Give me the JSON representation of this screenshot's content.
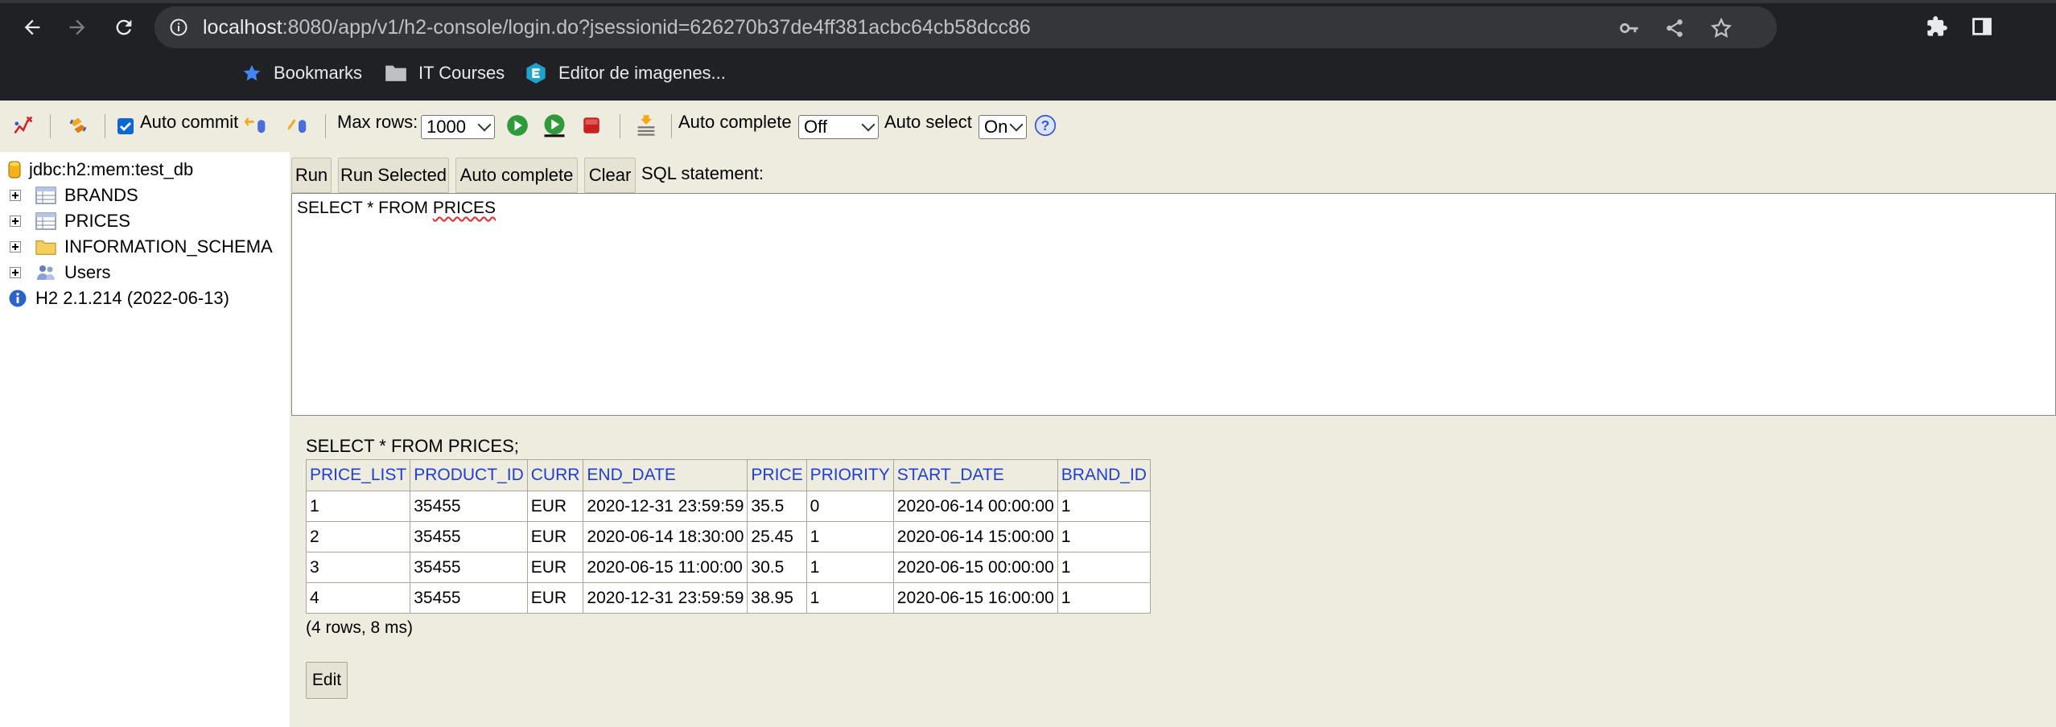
{
  "browser": {
    "url_host": "localhost",
    "url_rest": ":8080/app/v1/h2-console/login.do?jsessionid=626270b37de4ff381acbc64cb58dcc86",
    "bookmarks": [
      {
        "label": "Bookmarks",
        "icon": "star-icon"
      },
      {
        "label": "IT Courses",
        "icon": "folder-icon"
      },
      {
        "label": "Editor de imagenes...",
        "icon": "editor-logo-icon"
      }
    ]
  },
  "toolbar": {
    "auto_commit_label": "Auto commit",
    "auto_commit_checked": true,
    "max_rows_label": "Max rows:",
    "max_rows_value": "1000",
    "auto_complete_label": "Auto complete",
    "auto_complete_value": "Off",
    "auto_select_label": "Auto select",
    "auto_select_value": "On",
    "help": "?"
  },
  "tree": {
    "connection": "jdbc:h2:mem:test_db",
    "items": [
      {
        "label": "BRANDS",
        "icon": "table-icon"
      },
      {
        "label": "PRICES",
        "icon": "table-icon"
      },
      {
        "label": "INFORMATION_SCHEMA",
        "icon": "folder-icon"
      },
      {
        "label": "Users",
        "icon": "users-icon"
      }
    ],
    "version": "H2 2.1.214 (2022-06-13)"
  },
  "query": {
    "run": "Run",
    "run_selected": "Run Selected",
    "auto_complete": "Auto complete",
    "clear": "Clear",
    "sql_label": "SQL statement:",
    "sql_text_prefix": "SELECT * FROM ",
    "sql_text_table": "PRICES"
  },
  "result": {
    "statement": "SELECT * FROM PRICES;",
    "columns": [
      "PRICE_LIST",
      "PRODUCT_ID",
      "CURR",
      "END_DATE",
      "PRICE",
      "PRIORITY",
      "START_DATE",
      "BRAND_ID"
    ],
    "rows": [
      [
        "1",
        "35455",
        "EUR",
        "2020-12-31 23:59:59",
        "35.5",
        "0",
        "2020-06-14 00:00:00",
        "1"
      ],
      [
        "2",
        "35455",
        "EUR",
        "2020-06-14 18:30:00",
        "25.45",
        "1",
        "2020-06-14 15:00:00",
        "1"
      ],
      [
        "3",
        "35455",
        "EUR",
        "2020-06-15 11:00:00",
        "30.5",
        "1",
        "2020-06-15 00:00:00",
        "1"
      ],
      [
        "4",
        "35455",
        "EUR",
        "2020-12-31 23:59:59",
        "38.95",
        "1",
        "2020-06-15 16:00:00",
        "1"
      ]
    ],
    "summary": "(4 rows, 8 ms)",
    "edit": "Edit"
  },
  "colors": {
    "chrome_bg": "#202124",
    "h2_panel": "#eeebdf",
    "header_link": "#1f3fd0"
  }
}
